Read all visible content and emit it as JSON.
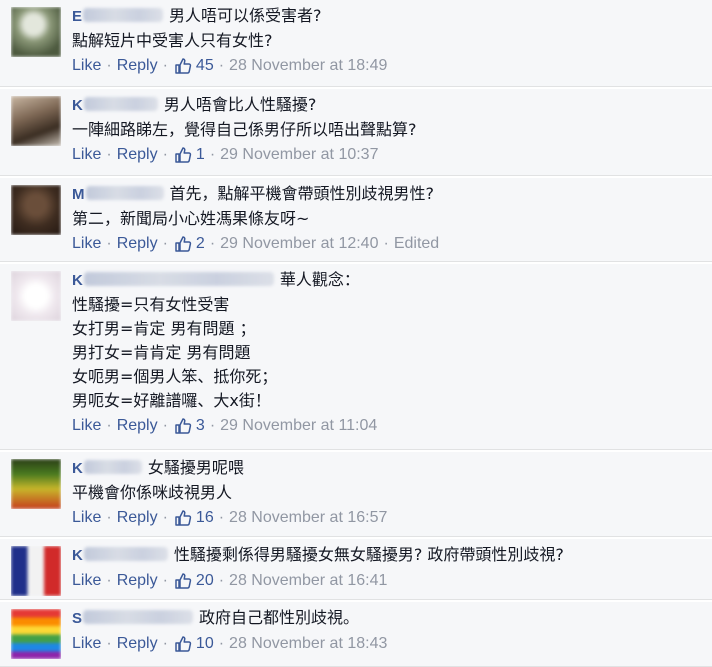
{
  "comments": [
    {
      "initial": "E",
      "lines": [
        "男人唔可以係受害者?",
        "點解短片中受害人只有女性?"
      ],
      "like_label": "Like",
      "reply_label": "Reply",
      "likes": "45",
      "timestamp": "28 November at 18:49",
      "edited": ""
    },
    {
      "initial": "K",
      "lines": [
        "男人唔會比人性騷擾?",
        "一陣細路睇左，覺得自己係男仔所以唔出聲點算?"
      ],
      "like_label": "Like",
      "reply_label": "Reply",
      "likes": "1",
      "timestamp": "29 November at 10:37",
      "edited": ""
    },
    {
      "initial": "M",
      "lines": [
        "首先，點解平機會帶頭性別歧視男性?",
        "第二，新聞局小心姓馮果條友呀~"
      ],
      "like_label": "Like",
      "reply_label": "Reply",
      "likes": "2",
      "timestamp": "29 November at 12:40",
      "edited": "Edited"
    },
    {
      "initial": "K",
      "lines": [
        "華人觀念：",
        "性騷擾=只有女性受害",
        "女打男=肯定 男有問題 ；",
        "男打女=肯肯定 男有問題",
        "女呃男=個男人笨、抵你死；",
        "男呃女=好離譜囉、大x街！"
      ],
      "like_label": "Like",
      "reply_label": "Reply",
      "likes": "3",
      "timestamp": "29 November at 11:04",
      "edited": ""
    },
    {
      "initial": "K",
      "lines": [
        "女騷擾男呢喂",
        "平機會你係咪歧視男人"
      ],
      "like_label": "Like",
      "reply_label": "Reply",
      "likes": "16",
      "timestamp": "28 November at 16:57",
      "edited": ""
    },
    {
      "initial": "K",
      "lines": [
        "性騷擾剩係得男騷擾女無女騷擾男? 政府帶頭性別歧視?"
      ],
      "like_label": "Like",
      "reply_label": "Reply",
      "likes": "20",
      "timestamp": "28 November at 16:41",
      "edited": ""
    },
    {
      "initial": "S",
      "lines": [
        "政府自己都性別歧視。"
      ],
      "like_label": "Like",
      "reply_label": "Reply",
      "likes": "10",
      "timestamp": "28 November at 18:43",
      "edited": ""
    }
  ],
  "colors": {
    "link": "#3b5998",
    "meta": "#9197a3",
    "text": "#141823",
    "row_background": "#f6f7f9"
  },
  "icons": {
    "like": "thumbs-up-icon"
  }
}
